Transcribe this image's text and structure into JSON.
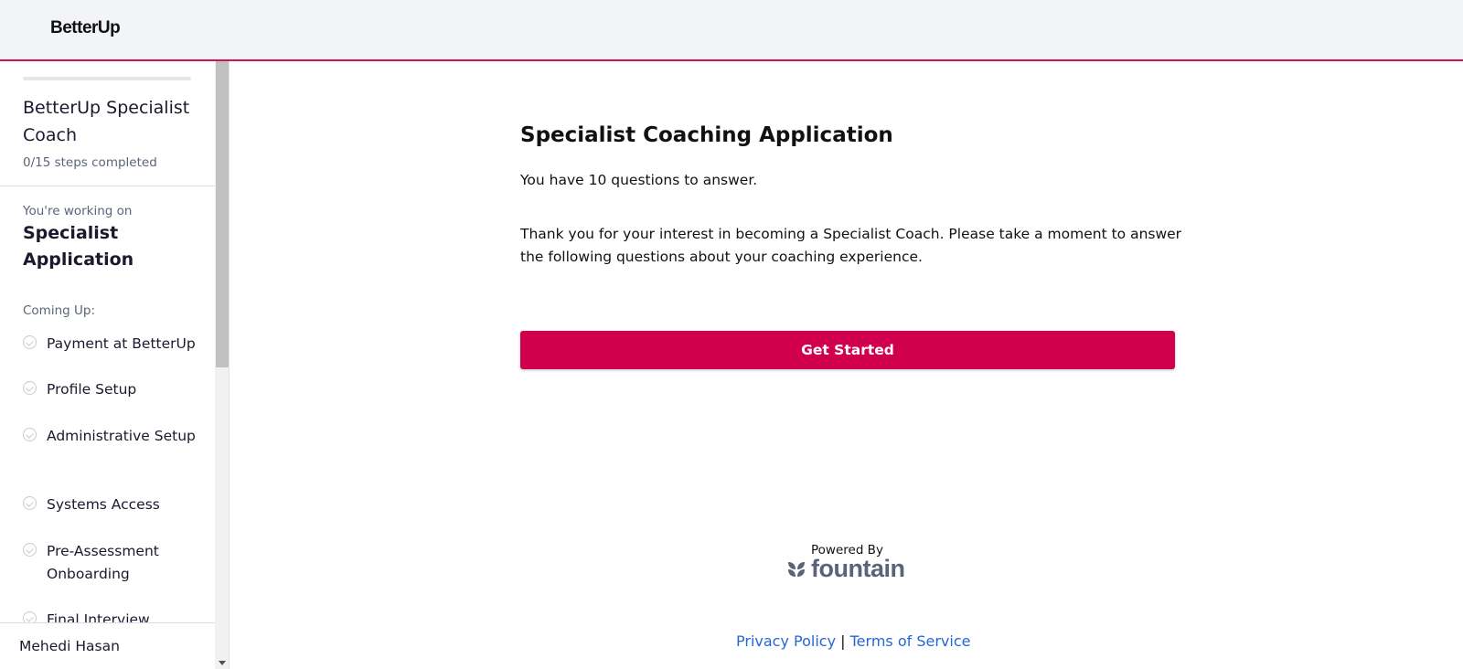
{
  "header": {
    "logo_text": "BetterUp",
    "accent_color": "#d0134f"
  },
  "sidebar": {
    "progress_fraction": 0.0,
    "program_title": "BetterUp Specialist Coach",
    "steps_completed": "0/15 steps completed",
    "working_on_label": "You're working on",
    "current_step": "Specialist Application",
    "coming_up_label": "Coming Up:",
    "upcoming_steps": [
      {
        "label": "Payment at BetterUp"
      },
      {
        "label": "Profile Setup"
      },
      {
        "label": "Administrative Setup"
      },
      {
        "label": "Systems Access"
      },
      {
        "label": "Pre-Assessment Onboarding"
      },
      {
        "label": "Final Interview"
      }
    ],
    "user_name": "Mehedi Hasan"
  },
  "main": {
    "title": "Specialist Coaching Application",
    "question_count_text": "You have 10 questions to answer.",
    "intro_text": "Thank you for your interest in becoming a Specialist Coach. Please take a moment to answer the following questions about your coaching experience.",
    "start_button_label": "Get Started",
    "button_color": "#d0004f"
  },
  "footer": {
    "powered_by": "Powered By",
    "brand_name": "fountain",
    "privacy_link": "Privacy Policy",
    "separator": "|",
    "terms_link": "Terms of Service",
    "link_color": "#2467d6"
  }
}
